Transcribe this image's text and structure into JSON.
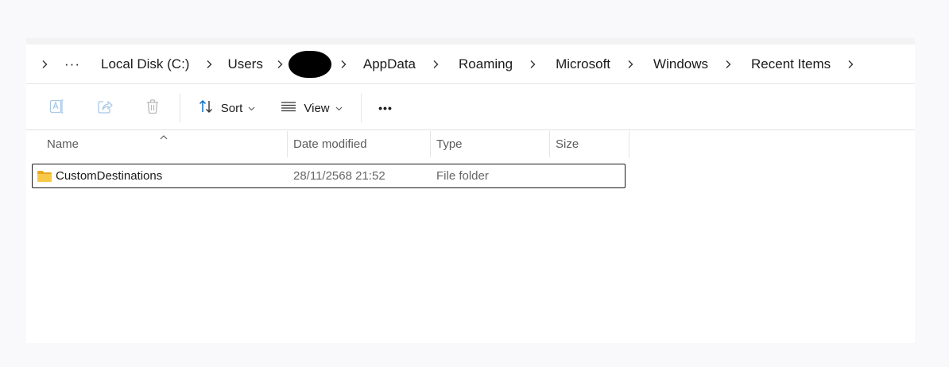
{
  "breadcrumb": {
    "overflow": "···",
    "items": [
      "Local Disk (C:)",
      "Users",
      "AppData",
      "Roaming",
      "Microsoft",
      "Windows",
      "Recent Items"
    ]
  },
  "toolbar": {
    "sort_label": "Sort",
    "view_label": "View",
    "more_label": "•••"
  },
  "columns": {
    "name": "Name",
    "date_modified": "Date modified",
    "type": "Type",
    "size": "Size"
  },
  "files": [
    {
      "name": "CustomDestinations",
      "date_modified": "28/11/2568 21:52",
      "type": "File folder",
      "size": ""
    }
  ],
  "colors": {
    "accent": "#0067c0",
    "folder": "#f8c948",
    "disabled_icon": "#a7c7e7"
  }
}
